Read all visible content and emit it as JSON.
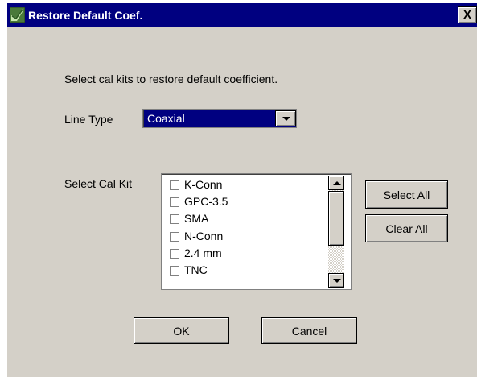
{
  "window": {
    "title": "Restore Default Coef.",
    "close_glyph": "X"
  },
  "instructions": "Select cal kits to restore default coefficient.",
  "line_type": {
    "label": "Line Type",
    "value": "Coaxial"
  },
  "cal_kit": {
    "label": "Select Cal Kit",
    "items": [
      {
        "label": "K-Conn",
        "checked": false
      },
      {
        "label": "GPC-3.5",
        "checked": false
      },
      {
        "label": "SMA",
        "checked": false
      },
      {
        "label": "N-Conn",
        "checked": false
      },
      {
        "label": "2.4 mm",
        "checked": false
      },
      {
        "label": "TNC",
        "checked": false
      }
    ]
  },
  "buttons": {
    "select_all": "Select All",
    "clear_all": "Clear All",
    "ok": "OK",
    "cancel": "Cancel"
  },
  "icons": {
    "title": "app-check-icon",
    "dropdown": "chevron-down-icon",
    "scroll_up": "scroll-up-icon",
    "scroll_down": "scroll-down-icon"
  },
  "colors": {
    "titlebar": "#000080",
    "dialog_bg": "#d4d0c8",
    "selection": "#000080"
  }
}
